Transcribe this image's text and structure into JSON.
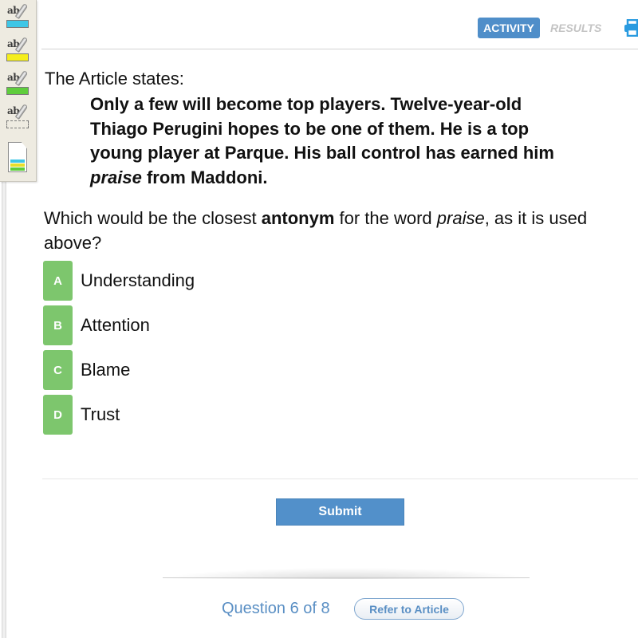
{
  "toolbar": {
    "tools": [
      {
        "label": "ab",
        "icon": "highlighter-blue-icon",
        "color": "#3ec6e6"
      },
      {
        "label": "ab",
        "icon": "highlighter-yellow-icon",
        "color": "#f5ee1c"
      },
      {
        "label": "ab",
        "icon": "highlighter-green-icon",
        "color": "#5fcd3c"
      },
      {
        "label": "ab",
        "icon": "highlighter-eraser-icon",
        "color": "none"
      },
      {
        "icon": "highlight-summary-document-icon"
      }
    ]
  },
  "nav": {
    "activity_label": "ACTIVITY",
    "results_label": "RESULTS",
    "print_icon": "printer-icon",
    "accent": "#4f8ec9"
  },
  "passage": {
    "intro": "The Article states:",
    "line1": "Only a few will become top players. Twelve-year-old",
    "line2": "Thiago Perugini hopes to be one of them. He is a top",
    "line3": "young player at Parque. His ball control has earned him",
    "line4_italic": "praise",
    "line4_rest": " from Maddoni."
  },
  "question": {
    "part1": "Which would be the closest ",
    "bold": "antonym",
    "part2": " for the word ",
    "italic": "praise",
    "part3": ", as it is used above?"
  },
  "options": [
    {
      "letter": "A",
      "text": "Understanding"
    },
    {
      "letter": "B",
      "text": "Attention"
    },
    {
      "letter": "C",
      "text": "Blame"
    },
    {
      "letter": "D",
      "text": "Trust"
    }
  ],
  "option_color": "#7dc66d",
  "submit_label": "Submit",
  "footer": {
    "question_counter": "Question 6 of 8",
    "refer_label": "Refer to Article"
  }
}
